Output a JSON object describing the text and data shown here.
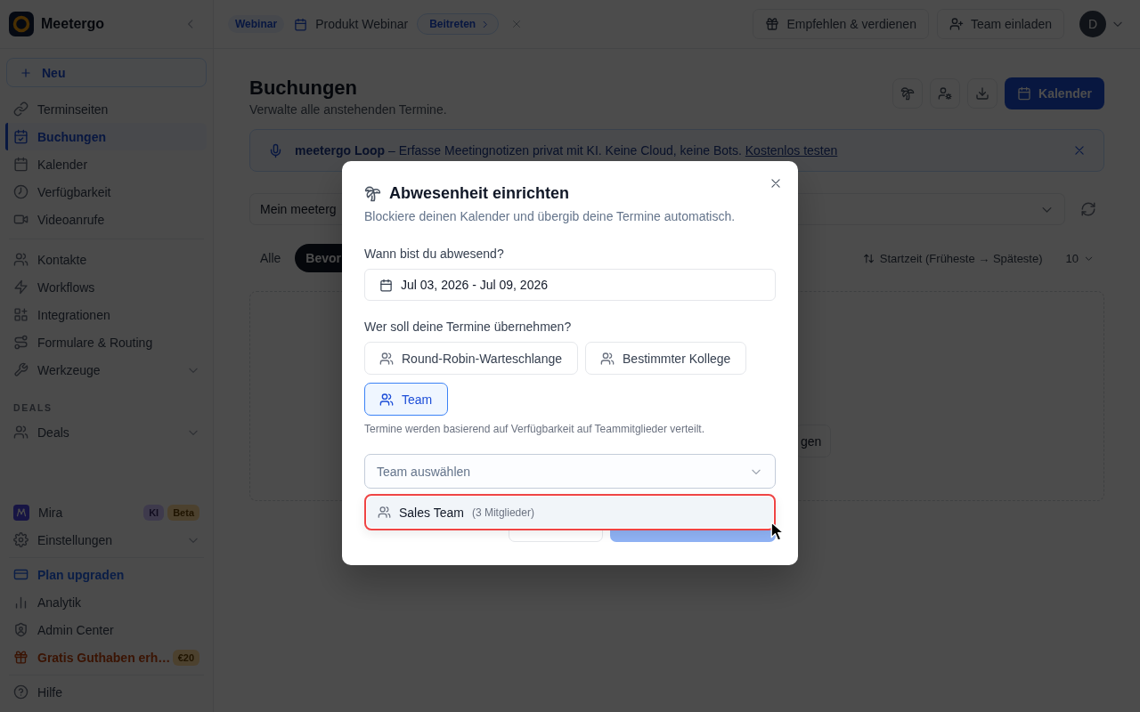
{
  "sidebar": {
    "brand": "Meetergo",
    "new_button": "Neu",
    "sections": [
      {
        "items": [
          {
            "label": "Terminseiten",
            "selected": false
          },
          {
            "label": "Buchungen",
            "selected": true
          },
          {
            "label": "Kalender",
            "selected": false
          },
          {
            "label": "Verfügbarkeit",
            "selected": false
          },
          {
            "label": "Videoanrufe",
            "selected": false
          }
        ]
      },
      {
        "items": [
          {
            "label": "Kontakte",
            "selected": false
          },
          {
            "label": "Workflows",
            "selected": false
          },
          {
            "label": "Integrationen",
            "selected": false
          },
          {
            "label": "Formulare & Routing",
            "selected": false
          },
          {
            "label": "Werkzeuge",
            "selected": false,
            "expanded": false
          }
        ]
      },
      {
        "title": "DEALS",
        "items": [
          {
            "label": "Deals",
            "selected": false,
            "expanded": false
          }
        ]
      }
    ],
    "footer_sections": [
      {
        "items": [
          {
            "label": "Mira",
            "selected": false,
            "badges": [
              {
                "text": "KI",
                "color": "#3e3a4c"
              },
              {
                "text": "Beta",
                "color": "#4c412e"
              }
            ]
          },
          {
            "label": "Einstellungen",
            "selected": false,
            "expanded": false
          }
        ]
      },
      {
        "items": [
          {
            "label": "Plan upgraden",
            "selected": false,
            "color": "#0b1e46"
          },
          {
            "label": "Analytik",
            "selected": false
          },
          {
            "label": "Admin Center",
            "selected": false
          },
          {
            "label": "Gratis Guthaben erh…",
            "selected": false,
            "color": "#3a1404",
            "badges": [
              {
                "text": "€20",
                "color": "#4c412e"
              }
            ]
          }
        ]
      },
      {
        "items": [
          {
            "label": "Hilfe",
            "selected": false
          }
        ]
      }
    ]
  },
  "topbar": {
    "webinar_badge": "Webinar",
    "webinar_title": "Produkt Webinar",
    "join_button": "Beitreten",
    "actions": [
      "Empfehlen & verdienen",
      "Team einladen"
    ],
    "avatar": "D"
  },
  "page": {
    "title": "Buchungen",
    "subtitle": "Verwalte alle anstehenden Termine.",
    "primary_button": "Kalender",
    "banner": {
      "text": "**meetergo Loop** – Erfasse Meetingnotizen privat mit KI. Keine Cloud, keine Bots.",
      "link": "Kostenlos testen"
    },
    "filter_select": {
      "value": "Mein meeterg"
    },
    "tabs": [
      {
        "label": "Alle",
        "selected": false
      },
      {
        "label": "Bevor",
        "selected": true
      }
    ],
    "sort": "Startzeit (Früheste → Späteste)",
    "page_size": "10",
    "empty_state_button": "gen"
  },
  "modal": {
    "title": "Abwesenheit einrichten",
    "subtitle": "Blockiere deinen Kalender und übergib deine Termine automatisch.",
    "date_label": "Wann bist du abwesend?",
    "date_range": "Jul 03, 2026 - Jul 09, 2026",
    "handover_label": "Wer soll deine Termine übernehmen?",
    "handover_options": [
      {
        "label": "Round-Robin-Warteschlange",
        "selected": false
      },
      {
        "label": "Bestimmter Kollege",
        "selected": false
      },
      {
        "label": "Team",
        "selected": true
      }
    ],
    "hint": "Termine werden basierend auf Verfügbarkeit auf Teammitglieder verteilt.",
    "team_select": {
      "placeholder": "Team auswählen",
      "expanded": true
    },
    "team_options": [
      {
        "name": "Sales Team",
        "members": "(3 Mitglieder)",
        "hovered": true
      }
    ],
    "highlighted": true,
    "footer_buttons": [
      {
        "kind": "secondary"
      },
      {
        "kind": "primary",
        "disabled": true
      }
    ]
  }
}
